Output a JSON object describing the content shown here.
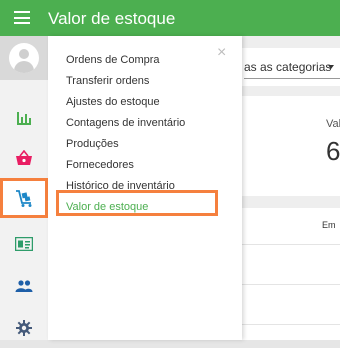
{
  "header": {
    "title": "Valor de estoque"
  },
  "icons": {
    "menu": "hamburger-icon",
    "avatar": "user-avatar",
    "rail": [
      "analytics-icon",
      "basket-icon",
      "inventory-cart-icon",
      "id-card-icon",
      "people-icon",
      "gear-icon"
    ]
  },
  "colors": {
    "brand": "#4caf50",
    "highlight": "#f5803e",
    "icon_active": "#1e88c8"
  },
  "background": {
    "category_select": "as as categorias",
    "card_label": "Val",
    "card_value": "6",
    "list_header": "Em"
  },
  "menu": {
    "close": "×",
    "items": [
      "Ordens de Compra",
      "Transferir ordens",
      "Ajustes do estoque",
      "Contagens de inventário",
      "Produções",
      "Fornecedores",
      "Histórico de inventário",
      "Valor de estoque"
    ],
    "selected": "Valor de estoque"
  }
}
